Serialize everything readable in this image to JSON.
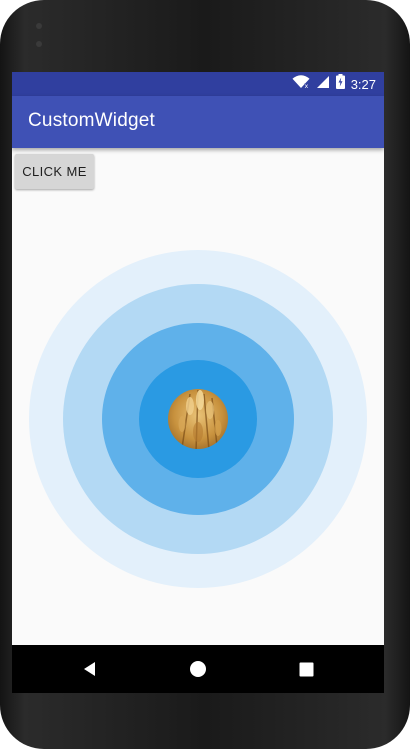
{
  "status_bar": {
    "time": "3:27",
    "icons": [
      "wifi-icon",
      "signal-icon",
      "battery-icon"
    ],
    "color": "#303f9f"
  },
  "app_bar": {
    "title": "CustomWidget",
    "color": "#3f51b5"
  },
  "content": {
    "button_label": "CLICK ME",
    "widget": {
      "ring_colors": [
        "#e3f0fb",
        "#b3d9f4",
        "#5fb1ea",
        "#2a9ae3"
      ],
      "center_image": "wheat-image"
    }
  },
  "nav_bar": {
    "icons": [
      "back-icon",
      "home-icon",
      "recents-icon"
    ]
  }
}
